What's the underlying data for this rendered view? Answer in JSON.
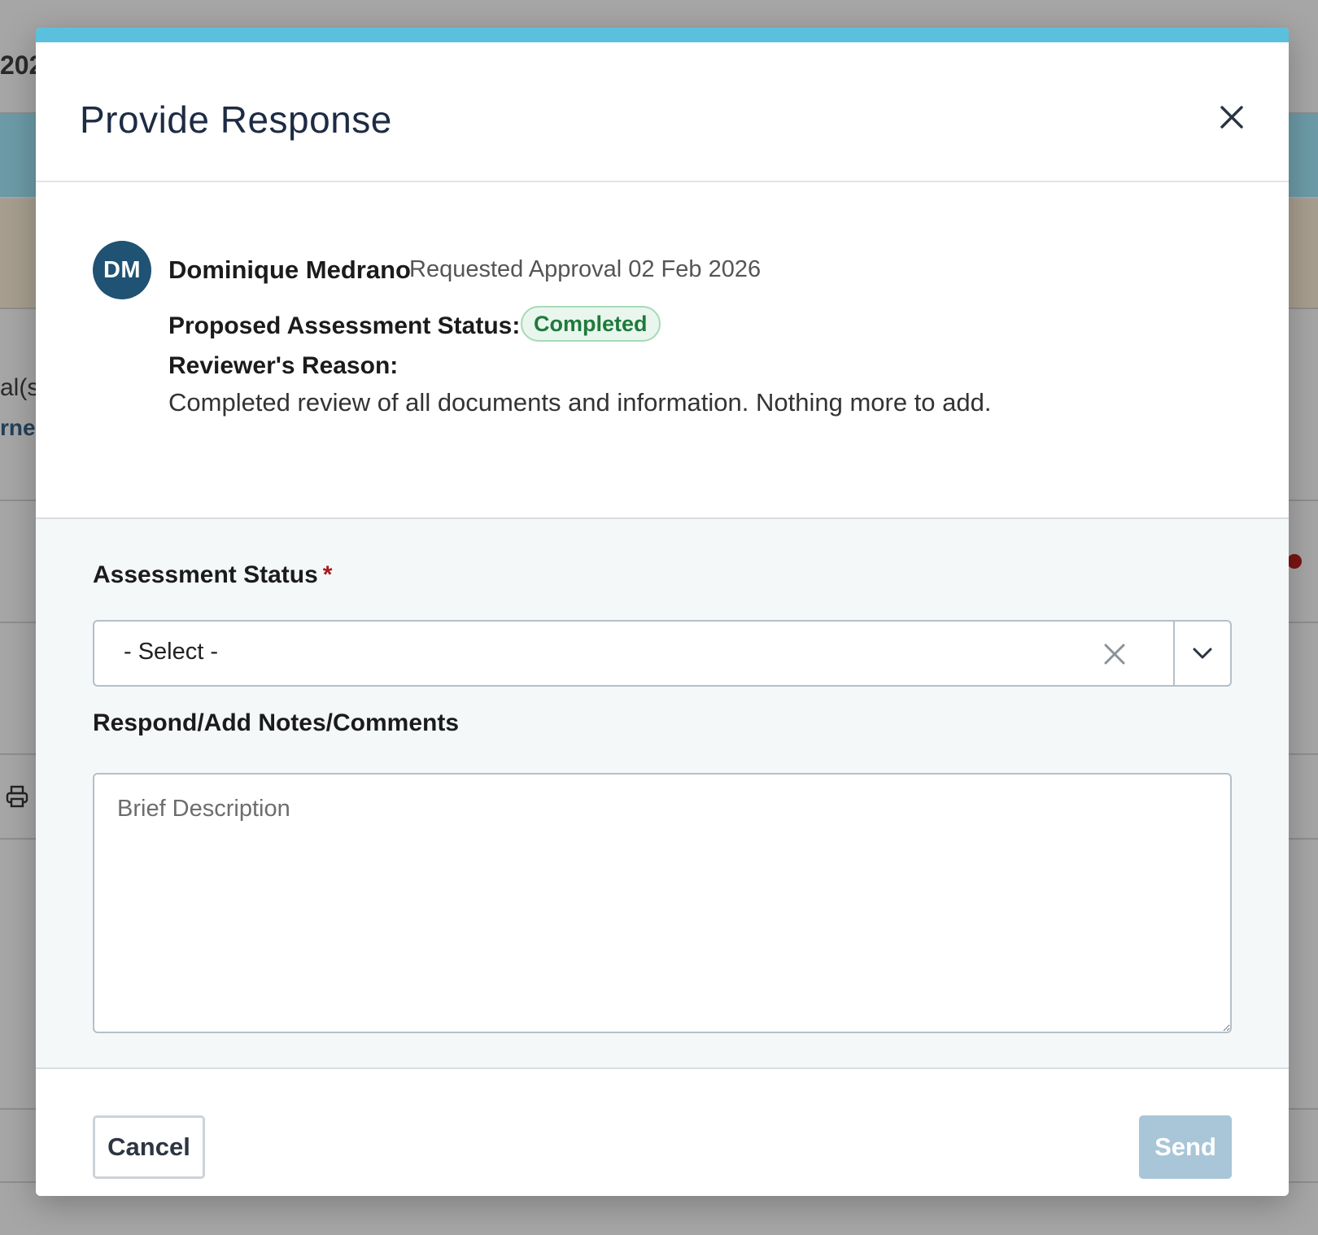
{
  "background": {
    "fragments": [
      "202",
      "al(s)",
      "rne"
    ],
    "icons": [
      "printer-icon"
    ]
  },
  "modal": {
    "title": "Provide Response",
    "close_icon": "close-icon",
    "accent_color": "#5bc0de"
  },
  "request": {
    "avatar_initials": "DM",
    "avatar_color": "#1f5273",
    "requester_name": "Dominique Medrano",
    "request_meta": "Requested Approval 02 Feb 2026",
    "proposed_status_label": "Proposed Assessment Status:",
    "proposed_status_value": "Completed",
    "reason_label": "Reviewer's Reason:",
    "reason_text": "Completed review of all documents and information. Nothing more to add."
  },
  "form": {
    "status_label": "Assessment Status",
    "required_marker": "*",
    "status_selected": "- Select -",
    "notes_label": "Respond/Add Notes/Comments",
    "notes_placeholder": "Brief Description",
    "notes_value": ""
  },
  "footer": {
    "cancel_label": "Cancel",
    "send_label": "Send",
    "send_color": "#a9c6d8"
  }
}
